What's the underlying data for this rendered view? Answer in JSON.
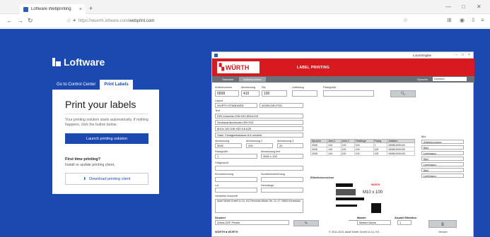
{
  "browser": {
    "tab_title": "Loftware Webprinting",
    "url_prefix": "https://wuerth.lofware.com/",
    "url_domain": "webprint.com",
    "icons": [
      "lock-icon",
      "star-icon",
      "extensions-icon",
      "menu-icon"
    ]
  },
  "brand": {
    "name": "Loftware"
  },
  "tabs": [
    {
      "label": "Go to Control Center",
      "active": false
    },
    {
      "label": "Print Labels",
      "active": true
    }
  ],
  "card": {
    "title": "Print your labels",
    "description": "Your printing solution starts automatically. If nothing happens, click the button below.",
    "launch_button": "Launch printing solution",
    "first_time_title": "First time printing?",
    "first_time_sub": "Install or update printing client.",
    "download_button": "Download printing client"
  },
  "app": {
    "user": "Local Engine",
    "brand": "WÜRTH",
    "banner_title": "LABEL PRINTING",
    "subtabs": [
      "Standard",
      "Artikelnummer"
    ],
    "language_label": "Sprache",
    "language_value": "Deutsch",
    "fields": {
      "artikelnummer_label": "Artikelnummer",
      "artikelnummer_value": "0008",
      "abmessung_label": "Abmessung",
      "abmessung_value": "410",
      "stk_label": "Stk",
      "stk_value": "100",
      "lieferlang_label": "Lieferlang",
      "packgroesse_label": "Packgröße",
      "layout_label": "Layout",
      "layout_value": "WURTH STANDARD",
      "size_value": "40X55-DELFGD",
      "text_label": "Text",
      "text_lines": [
        "DIN Vorschau DIN 933 M10x100",
        "Sechskantschraube DIN 933",
        "M10x 100 DIN 933 8.8 A2K",
        "Stahl, Festigkeitsklasse 8.8 verzinkt"
      ],
      "abmessung1_label": "Abmessung",
      "abmessung1_value": "3000",
      "abmessung2_label": "Abmessung 2",
      "abmessung2_value": "200",
      "abmessung3_label": "Abmessung 3",
      "abmessung3_value": "20",
      "packgroesse2_label": "Packgröße",
      "packgroesse2_value": "1",
      "abmessung_text_label": "Abmessung text",
      "abmessung_text_value": "4000 x 100",
      "fuellgewicht_label": "Füllgewicht",
      "fuellgewicht_value": "",
      "kennzeichnung_label": "Kennzeichnung",
      "kennzeichnung_value": "",
      "sonderbezeichnung_label": "Sonderbezeichnung",
      "sonderbezeichnung_value": "",
      "lot_label": "Lot",
      "lot_value": "",
      "nennlaenge_label": "Nennlänge",
      "nennlaenge_value": "",
      "adresse_label": "Hersteller Anschrift",
      "adresse_value": "Adolf Würth GmbH & Co. KG  Reinhold-Würth-Str. 12-17  74653 Künzelsau",
      "drucker_label": "Drucker",
      "drucker_value": "Zebra ZDF Printer",
      "anzahl_label": "Anzahl Etiketten",
      "anzahl_value": "1",
      "master_label": "Master",
      "master_value": "Master Name"
    },
    "table": {
      "headers": [
        "Sprache",
        "Abm.1",
        "Abm.2",
        "Festlänge",
        "Packg.",
        "Artikelnr."
      ],
      "rows": [
        [
          "0008",
          "410",
          "100",
          "100",
          "1",
          "000841000100"
        ],
        [
          "0008",
          "410",
          "100",
          "100",
          "100",
          "000841000100"
        ],
        [
          "0008",
          "410",
          "100",
          "100",
          "100",
          "000841000100"
        ]
      ]
    },
    "right_list_label": "Bild",
    "right_list": [
      "Artikelnummer",
      "Bild",
      "Lieferlang",
      "Bild",
      "Lieferlang",
      "Bild",
      "Lieferlang"
    ],
    "preview_label": "Etikettenvorschau",
    "preview_text": "M10 x 100",
    "preview_brand": "WÜRTH",
    "footer_left": "WÜRTH ■ WÜRTH",
    "footer_mid": "© 2011-2021 Adolf Würth GmbH & Co. KG",
    "footer_right": "Version"
  },
  "colors": {
    "page_bg": "#1a49b0",
    "accent": "#1a49b0",
    "wuerth_red": "#d71920"
  }
}
